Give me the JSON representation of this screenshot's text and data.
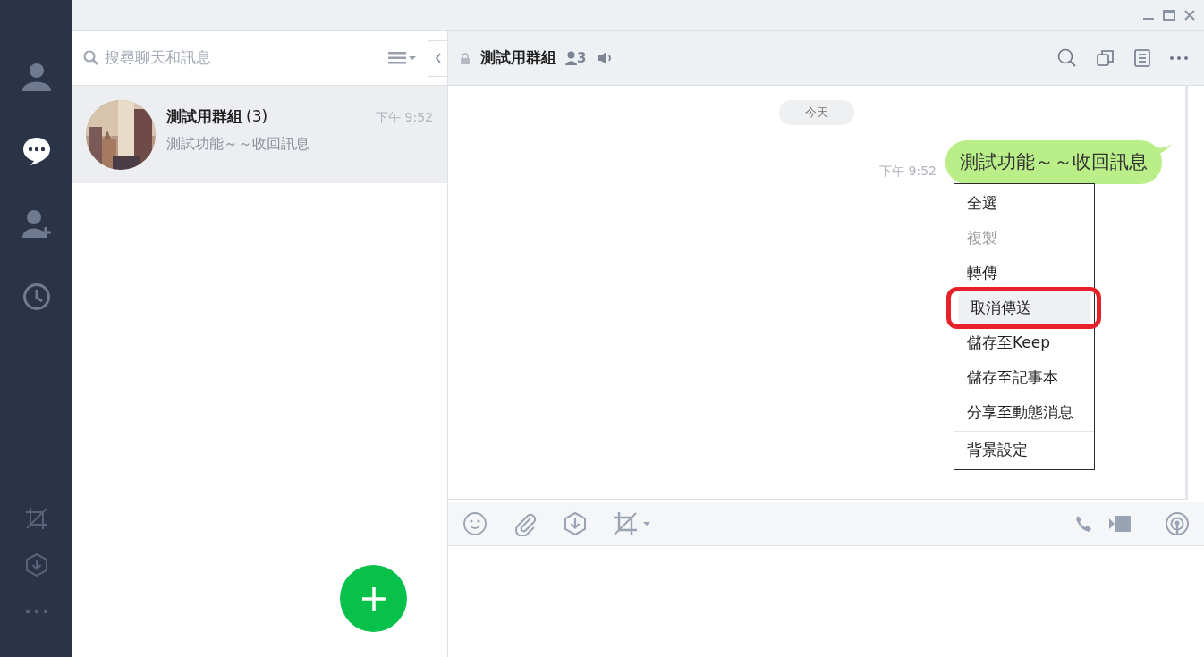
{
  "nav": [
    {
      "kind": "friends",
      "selected": false
    },
    {
      "kind": "chats",
      "selected": true
    },
    {
      "kind": "add-friend",
      "selected": false
    },
    {
      "kind": "history",
      "selected": false
    }
  ],
  "nav_bottom": [
    {
      "kind": "crop"
    },
    {
      "kind": "download"
    },
    {
      "kind": "more"
    }
  ],
  "search": {
    "placeholder": "搜尋聊天和訊息"
  },
  "chats": [
    {
      "name": "測試用群組",
      "count": "(3)",
      "time": "下午 9:52",
      "preview": "測試功能～～收回訊息",
      "selected": true
    }
  ],
  "header": {
    "title": "測試用群組",
    "members": "3"
  },
  "date_divider": "今天",
  "messages": [
    {
      "text": "測試功能～～收回訊息",
      "time": "下午 9:52"
    }
  ],
  "context_menu": [
    {
      "label": "全選",
      "disabled": false,
      "highlighted": false,
      "divider_before": false
    },
    {
      "label": "複製",
      "disabled": true,
      "highlighted": false,
      "divider_before": false
    },
    {
      "label": "轉傳",
      "disabled": false,
      "highlighted": false,
      "divider_before": false
    },
    {
      "label": "取消傳送",
      "disabled": false,
      "highlighted": true,
      "divider_before": false
    },
    {
      "label": "儲存至Keep",
      "disabled": false,
      "highlighted": false,
      "divider_before": false
    },
    {
      "label": "儲存至記事本",
      "disabled": false,
      "highlighted": false,
      "divider_before": false
    },
    {
      "label": "分享至動態消息",
      "disabled": false,
      "highlighted": false,
      "divider_before": false
    },
    {
      "label": "背景設定",
      "disabled": false,
      "highlighted": false,
      "divider_before": true
    }
  ]
}
